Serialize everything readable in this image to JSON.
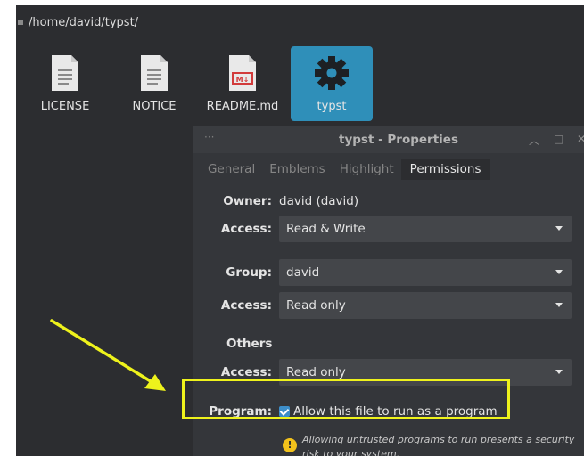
{
  "path": "/home/david/typst/",
  "files": [
    {
      "name": "LICENSE",
      "icon": "text-file-icon"
    },
    {
      "name": "NOTICE",
      "icon": "text-file-icon"
    },
    {
      "name": "README.md",
      "icon": "markdown-file-icon",
      "badge": "M↓"
    },
    {
      "name": "typst",
      "icon": "gear-executable-icon"
    }
  ],
  "dialog": {
    "title": "typst - Properties",
    "dots": "···",
    "tabs": [
      "General",
      "Emblems",
      "Highlight",
      "Permissions"
    ],
    "owner_label": "Owner:",
    "owner_value": "david (david)",
    "access_label": "Access:",
    "owner_access": "Read & Write",
    "group_label": "Group:",
    "group_value": "david",
    "group_access": "Read only",
    "others_label": "Others",
    "others_access": "Read only",
    "program_label": "Program:",
    "program_checkbox": "Allow this file to run as a program",
    "program_checked": true,
    "warning": "Allowing untrusted programs to run presents a security risk to your system."
  },
  "colors": {
    "highlight": "#eef21c",
    "selection": "#2f8fb9",
    "checkbox": "#3d8ec9",
    "warning": "#f2c21b"
  }
}
